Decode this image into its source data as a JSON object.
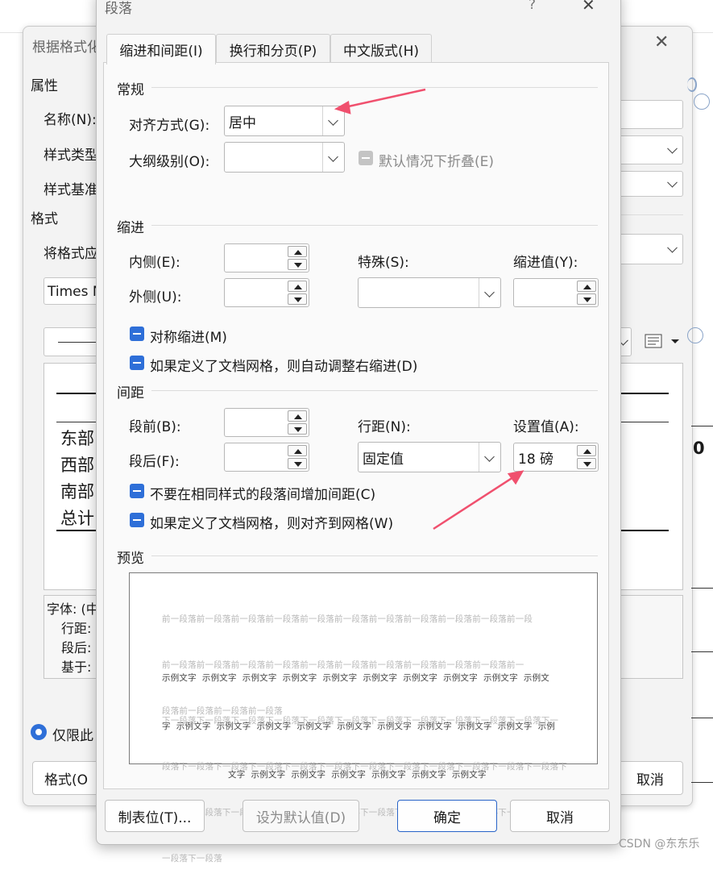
{
  "colors": {
    "accent": "#2e6fd8",
    "arrow": "#f0506e"
  },
  "background_dialog": {
    "title": "根据格式化",
    "section_properties": "属性",
    "name_label": "名称(N):",
    "style_type_label": "样式类型",
    "style_based_label": "样式基准",
    "section_format": "格式",
    "apply_to_label": "将格式应",
    "font_value": "Times N",
    "table_rows": [
      "东部",
      "西部",
      "南部",
      "总计"
    ],
    "right_number": "0",
    "desc_lines": [
      "字体: (中",
      "行距:",
      "段后:",
      "基于:"
    ],
    "radio_label": "仅限此",
    "format_button": "格式(O",
    "cancel_button": "取消"
  },
  "dialog": {
    "title": "段落",
    "help": "?",
    "close": "✕",
    "tabs": [
      {
        "label": "缩进和间距(I)",
        "active": true
      },
      {
        "label": "换行和分页(P)",
        "active": false
      },
      {
        "label": "中文版式(H)",
        "active": false
      }
    ],
    "general": {
      "heading": "常规",
      "alignment_label": "对齐方式(G):",
      "alignment_value": "居中",
      "outline_label": "大纲级别(O):",
      "outline_value": "",
      "collapse_label": "默认情况下折叠(E)"
    },
    "indent": {
      "heading": "缩进",
      "inside_label": "内侧(E):",
      "outside_label": "外侧(U):",
      "special_label": "特殊(S):",
      "indent_value_label": "缩进值(Y):",
      "mirror_label": "对称缩进(M)",
      "auto_adjust_label": "如果定义了文档网格，则自动调整右缩进(D)"
    },
    "spacing": {
      "heading": "间距",
      "before_label": "段前(B):",
      "after_label": "段后(F):",
      "line_spacing_label": "行距(N):",
      "line_spacing_value": "固定值",
      "at_label": "设置值(A):",
      "at_value": "18 磅",
      "no_space_label": "不要在相同样式的段落间增加间距(C)",
      "snap_grid_label": "如果定义了文档网格，则对齐到网格(W)"
    },
    "preview": {
      "heading": "预览",
      "prev_lines": [
        "前一段落前一段落前一段落前一段落前一段落前一段落前一段落前一段落前一段落前一段落前一段",
        "前一段落前一段落前一段落前一段落前一段落前一段落前一段落前一段落前一段落前一段落前一",
        "段落前一段落前一段落前一段落"
      ],
      "sample_lines": [
        "示例文字  示例文字  示例文字  示例文字  示例文字  示例文字  示例文字  示例文字  示例文字  示例文",
        "字  示例文字  示例文字  示例文字  示例文字  示例文字  示例文字  示例文字  示例文字  示例文字  示例",
        "文字  示例文字  示例文字  示例文字  示例文字  示例文字  示例文字"
      ],
      "next_lines": [
        "下一段落下一段落下一段落下一段落下一段落下一段落下一段落下一段落下一段落下一段落下一段落下一",
        "段落下一段落下一段落下一段落下一段落下一段落下一段落下一段落下一段落下一段落下一段落下一段落下",
        "一段落下一段落下一段落下一段落下一段落下一段落下一段落下一段落下一段落下一段落下一段落下一段落下",
        "一段落下一段落"
      ]
    },
    "buttons": {
      "tabs": "制表位(T)...",
      "set_default": "设为默认值(D)",
      "ok": "确定",
      "cancel": "取消"
    }
  },
  "watermark": "CSDN @东东乐"
}
